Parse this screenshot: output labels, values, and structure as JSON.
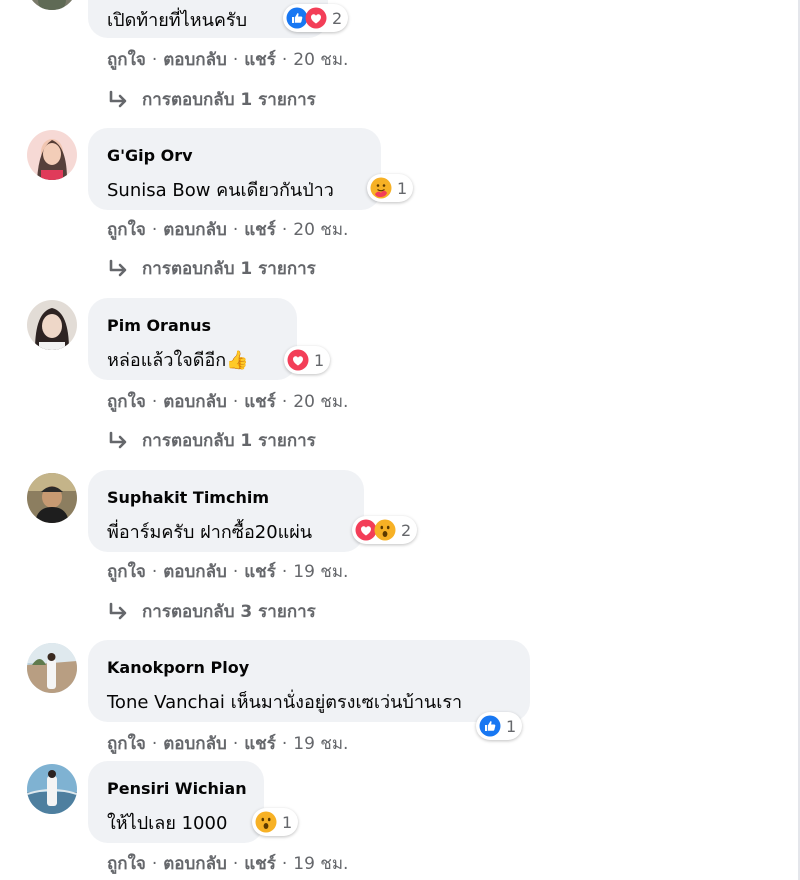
{
  "colors": {
    "like_blue": "#1877f2",
    "love_red": "#f33e58",
    "wow_yellow": "#f7b125",
    "muted": "#65676b",
    "bubble_bg": "#f0f2f5"
  },
  "comments": [
    {
      "name": "",
      "text": "เปิดท้ายที่ไหนครับ",
      "reactions": [
        "like-icon",
        "love-icon"
      ],
      "reaction_count": "2",
      "actions": {
        "like": "ถูกใจ",
        "reply": "ตอบกลับ",
        "share": "แชร์",
        "time": "20 ชม."
      },
      "replies": "การตอบกลับ 1 รายการ"
    },
    {
      "name": "G'Gip Orv",
      "text": "Sunisa Bow คนเดียวกันป่าว",
      "reactions": [
        "care-icon"
      ],
      "reaction_count": "1",
      "actions": {
        "like": "ถูกใจ",
        "reply": "ตอบกลับ",
        "share": "แชร์",
        "time": "20 ชม."
      },
      "replies": "การตอบกลับ 1 รายการ"
    },
    {
      "name": "Pim Oranus",
      "text": "หล่อแล้วใจดีอีก",
      "text_emoji": "👍",
      "reactions": [
        "love-icon"
      ],
      "reaction_count": "1",
      "actions": {
        "like": "ถูกใจ",
        "reply": "ตอบกลับ",
        "share": "แชร์",
        "time": "20 ชม."
      },
      "replies": "การตอบกลับ 1 รายการ"
    },
    {
      "name": "Suphakit Timchim",
      "text": "พี่อาร์มครับ ฝากซื้อ20แผ่น",
      "reactions": [
        "love-icon",
        "wow-icon"
      ],
      "reaction_count": "2",
      "actions": {
        "like": "ถูกใจ",
        "reply": "ตอบกลับ",
        "share": "แชร์",
        "time": "19 ชม."
      },
      "replies": "การตอบกลับ 3 รายการ"
    },
    {
      "name": "Kanokporn Ploy",
      "text": "Tone Vanchai เห็นมานั่งอยู่ตรงเซเว่นบ้านเรา",
      "reactions": [
        "like-icon"
      ],
      "reaction_count": "1",
      "actions": {
        "like": "ถูกใจ",
        "reply": "ตอบกลับ",
        "share": "แชร์",
        "time": "19 ชม."
      }
    },
    {
      "name": "Pensiri Wichian",
      "text": "ให้ไปเลย 1000",
      "reactions": [
        "wow-icon"
      ],
      "reaction_count": "1",
      "actions": {
        "like": "ถูกใจ",
        "reply": "ตอบกลับ",
        "share": "แชร์",
        "time": "19 ชม."
      }
    }
  ]
}
